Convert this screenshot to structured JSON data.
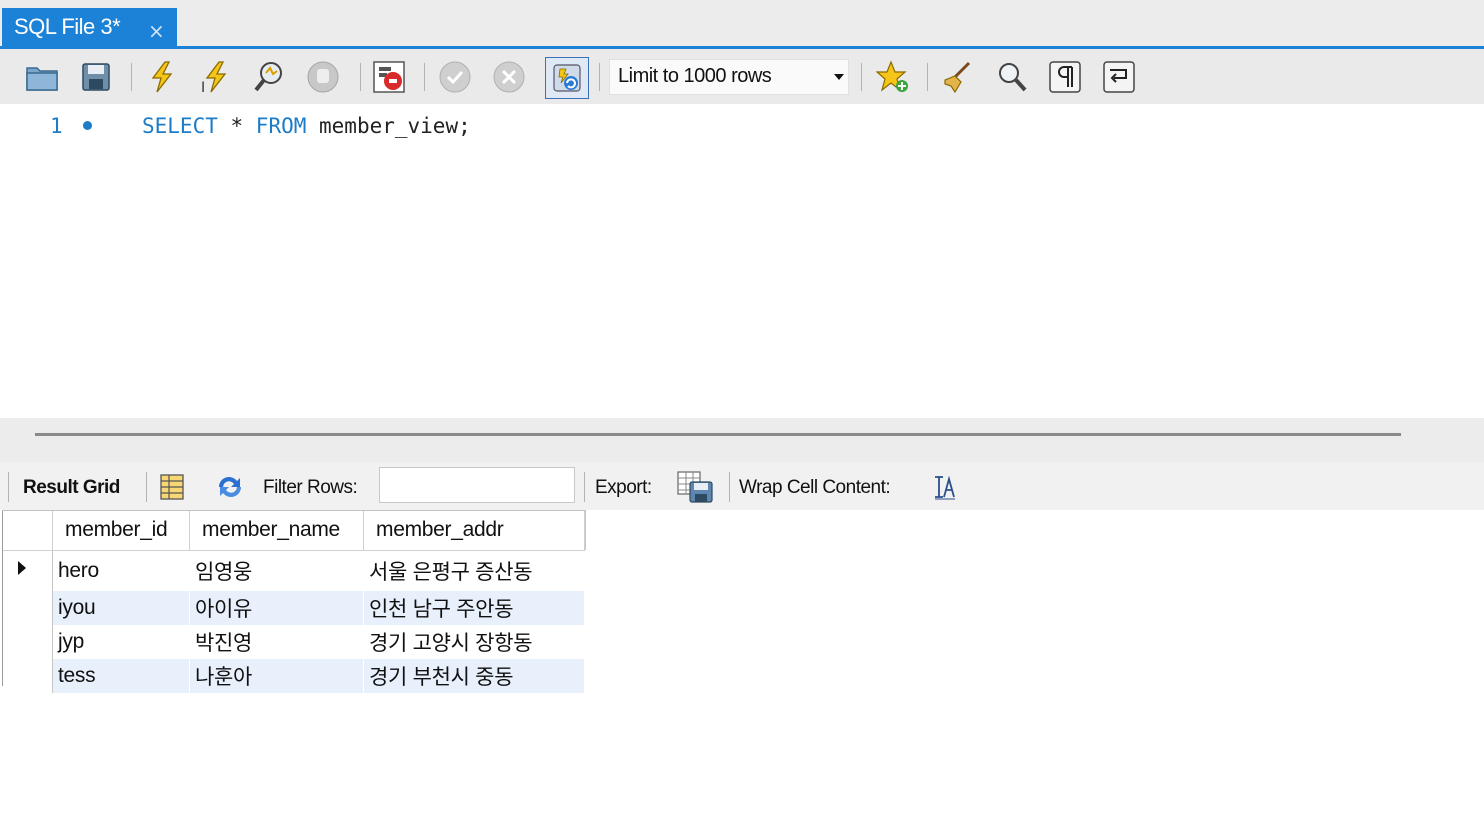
{
  "tab": {
    "label": "SQL File 3*",
    "close": "×"
  },
  "toolbar": {
    "limit_label": "Limit to 1000 rows",
    "icons": [
      "open-folder-icon",
      "save-icon",
      "execute-icon",
      "execute-current-icon",
      "explain-icon",
      "stop-icon",
      "toggle-error-icon",
      "commit-icon",
      "rollback-icon",
      "autocommit-icon",
      "add-snippet-icon",
      "beautify-icon",
      "find-icon",
      "invisible-chars-icon",
      "wrap-icon"
    ]
  },
  "editor": {
    "line_number": "1",
    "code_kw1": "SELECT",
    "code_mid": " * ",
    "code_kw2": "FROM",
    "code_rest": " member_view;"
  },
  "result_toolbar": {
    "result_grid_label": "Result Grid",
    "filter_label": "Filter Rows:",
    "filter_value": "",
    "export_label": "Export:",
    "wrap_label": "Wrap Cell Content:"
  },
  "grid": {
    "columns": [
      "member_id",
      "member_name",
      "member_addr"
    ],
    "rows": [
      [
        "hero",
        "임영웅",
        "서울 은평구 증산동"
      ],
      [
        "iyou",
        "아이유",
        "인천 남구 주안동"
      ],
      [
        "jyp",
        "박진영",
        "경기 고양시 장항동"
      ],
      [
        "tess",
        "나훈아",
        "경기 부천시 중동"
      ]
    ]
  },
  "colors": {
    "accent": "#1b82d7",
    "keyword": "#1c7cc7",
    "alt_row": "#e8f0fb"
  }
}
